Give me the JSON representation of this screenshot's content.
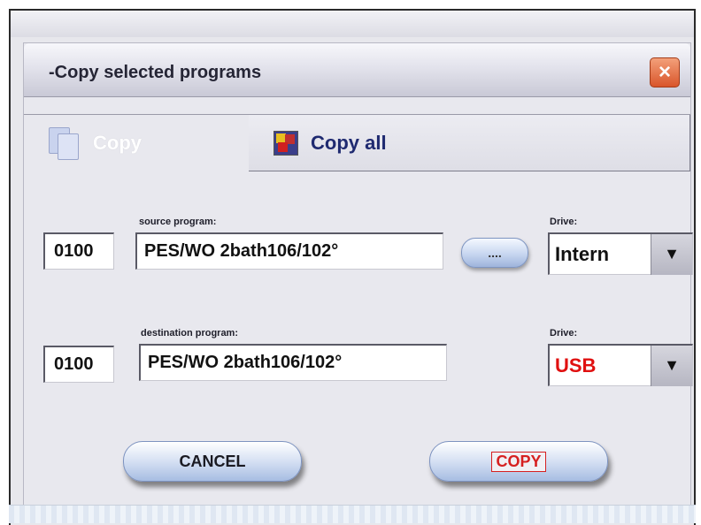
{
  "dialog": {
    "title": "-Copy selected programs",
    "close_label": "×"
  },
  "tabs": [
    {
      "label": "Copy",
      "active": true
    },
    {
      "label": "Copy all",
      "active": false
    }
  ],
  "source": {
    "label": "source program:",
    "number": "0100",
    "name": "PES/WO 2bath106/102°",
    "browse_label": "....",
    "drive_label": "Drive:",
    "drive_value": "Intern",
    "drive_color": "#111111"
  },
  "destination": {
    "label": "destination program:",
    "number": "0100",
    "name": "PES/WO 2bath106/102°",
    "drive_label": "Drive:",
    "drive_value": "USB",
    "drive_color": "#e01010"
  },
  "buttons": {
    "cancel": "CANCEL",
    "copy": "COPY"
  },
  "icons": {
    "close": "close-icon",
    "copy": "copy-pages-icon",
    "copy_all": "copy-all-icon",
    "dropdown": "chevron-down-icon"
  }
}
